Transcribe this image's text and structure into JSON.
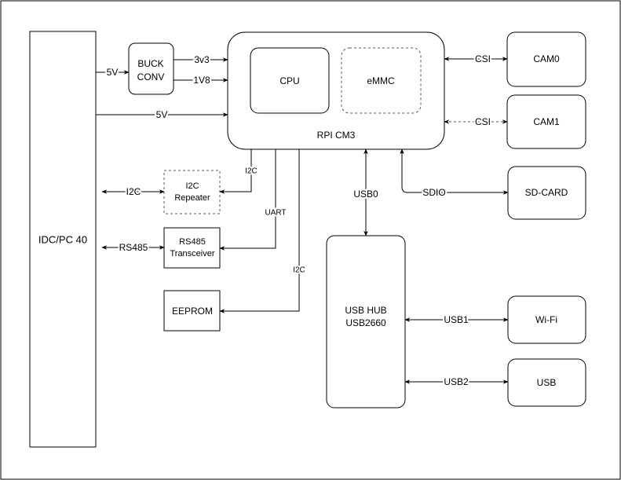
{
  "blocks": {
    "idc": "IDC/PC 40",
    "buck_line1": "BUCK",
    "buck_line2": "CONV",
    "rpi": "RPI CM3",
    "cpu": "CPU",
    "emmc": "eMMC",
    "cam0": "CAM0",
    "cam1": "CAM1",
    "sdcard": "SD-CARD",
    "wifi": "Wi-Fi",
    "usb": "USB",
    "usbhub_line1": "USB HUB",
    "usbhub_line2": "USB2660",
    "i2c_rep_line1": "I2C",
    "i2c_rep_line2": "Repeater",
    "rs485_line1": "RS485",
    "rs485_line2": "Transceiver",
    "eeprom": "EEPROM"
  },
  "connections": {
    "idc_buck": "5V",
    "buck_3v3": "3v3",
    "buck_1v8": "1V8",
    "idc_rpi_5v": "5V",
    "csi0": "CSI",
    "csi1": "CSI",
    "sdio": "SDIO",
    "usb0": "USB0",
    "usb1": "USB1",
    "usb2": "USB2",
    "rpi_i2c_rep": "I2C",
    "rpi_uart": "UART",
    "rpi_i2c_eeprom": "I2C",
    "idc_i2c": "I2C",
    "idc_rs485": "RS485"
  }
}
